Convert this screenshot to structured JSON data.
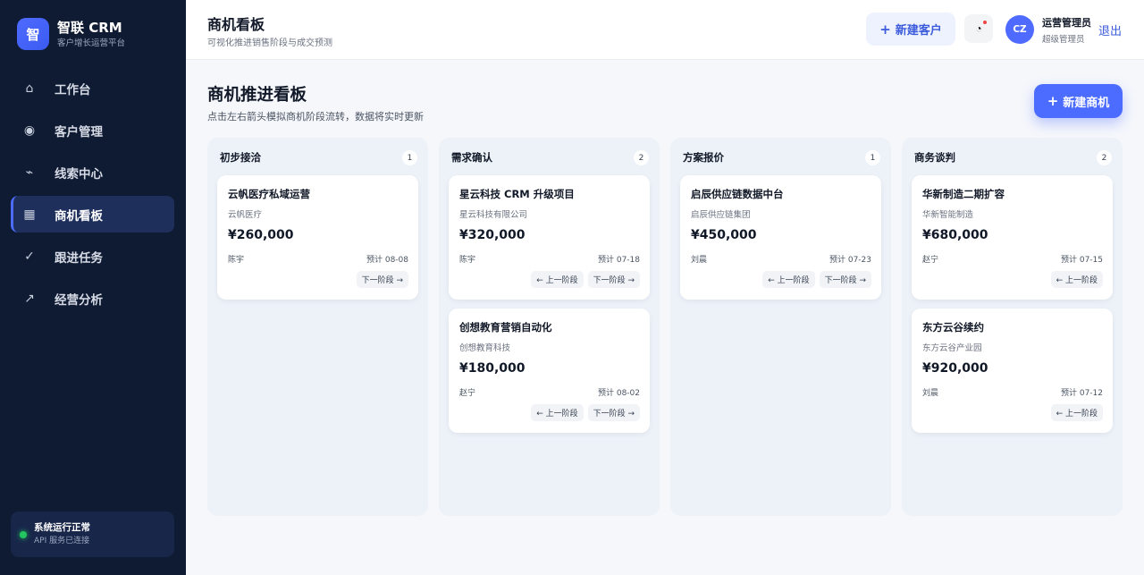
{
  "brand": {
    "logo": "智",
    "name": "智联 CRM",
    "subtitle": "客户增长运营平台"
  },
  "sidebar": {
    "items": [
      {
        "icon": "⌂",
        "label": "工作台"
      },
      {
        "icon": "◉",
        "label": "客户管理"
      },
      {
        "icon": "⌁",
        "label": "线索中心"
      },
      {
        "icon": "▦",
        "label": "商机看板"
      },
      {
        "icon": "✓",
        "label": "跟进任务"
      },
      {
        "icon": "↗",
        "label": "经营分析"
      }
    ],
    "status": {
      "title": "系统运行正常",
      "subtitle": "API 服务已连接"
    }
  },
  "header": {
    "title": "商机看板",
    "subtitle": "可视化推进销售阶段与成交预测",
    "new_customer_label": "新建客户",
    "notify_icon": "◔",
    "avatar": "CZ",
    "user_name": "运营管理员",
    "user_role": "超级管理员",
    "logout": "退出"
  },
  "main": {
    "title": "商机推进看板",
    "subtitle": "点击左右箭头模拟商机阶段流转，数据将实时更新",
    "new_opportunity_label": "新建商机",
    "prev_label": "← 上一阶段",
    "next_label": "下一阶段 →",
    "columns": [
      {
        "name": "初步接洽",
        "count": "1",
        "cards": [
          {
            "title": "云帆医疗私域运营",
            "company": "云帆医疗",
            "amount": "¥260,000",
            "owner": "陈宇",
            "date": "预计 08-08"
          }
        ]
      },
      {
        "name": "需求确认",
        "count": "2",
        "cards": [
          {
            "title": "星云科技 CRM 升级项目",
            "company": "星云科技有限公司",
            "amount": "¥320,000",
            "owner": "陈宇",
            "date": "预计 07-18"
          },
          {
            "title": "创想教育营销自动化",
            "company": "创想教育科技",
            "amount": "¥180,000",
            "owner": "赵宁",
            "date": "预计 08-02"
          }
        ]
      },
      {
        "name": "方案报价",
        "count": "1",
        "cards": [
          {
            "title": "启辰供应链数据中台",
            "company": "启辰供应链集团",
            "amount": "¥450,000",
            "owner": "刘晨",
            "date": "预计 07-23"
          }
        ]
      },
      {
        "name": "商务谈判",
        "count": "2",
        "cards": [
          {
            "title": "华新制造二期扩容",
            "company": "华新智能制造",
            "amount": "¥680,000",
            "owner": "赵宁",
            "date": "预计 07-15"
          },
          {
            "title": "东方云谷续约",
            "company": "东方云谷产业园",
            "amount": "¥920,000",
            "owner": "刘晨",
            "date": "预计 07-12"
          }
        ]
      }
    ]
  }
}
